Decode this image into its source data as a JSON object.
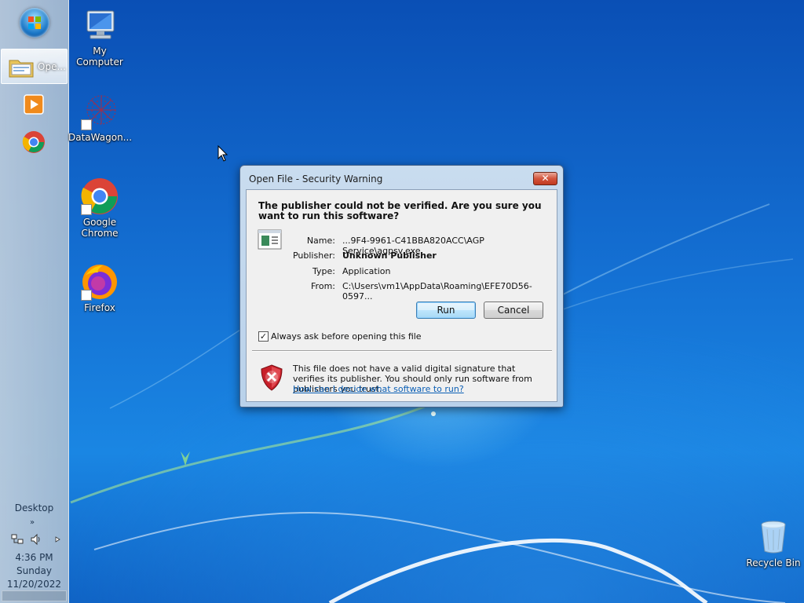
{
  "desktop": {
    "icons": [
      {
        "name": "My Computer",
        "icon": "computer-icon"
      },
      {
        "name": "DataWagon...",
        "icon": "datawagon-icon"
      },
      {
        "name": "Google Chrome",
        "icon": "chrome-icon"
      },
      {
        "name": "Firefox",
        "icon": "firefox-icon"
      },
      {
        "name": "Recycle Bin",
        "icon": "recycle-bin-icon"
      }
    ]
  },
  "taskbar": {
    "active_window_label": "Ope...",
    "pinned": [
      "media-player-icon",
      "chrome-icon"
    ],
    "desktop_label": "Desktop",
    "clock": {
      "time": "4:36 PM",
      "day": "Sunday",
      "date": "11/20/2022"
    }
  },
  "dialog": {
    "title": "Open File - Security Warning",
    "question": "The publisher could not be verified.  Are you sure you want to run this software?",
    "fields": [
      {
        "key": "Name:",
        "value": "...9F4-9961-C41BBA820ACC\\AGP Service\\agpsv.exe",
        "bold": false
      },
      {
        "key": "Publisher:",
        "value": "Unknown Publisher",
        "bold": true
      },
      {
        "key": "Type:",
        "value": "Application",
        "bold": false
      },
      {
        "key": "From:",
        "value": "C:\\Users\\vm1\\AppData\\Roaming\\EFE70D56-0597...",
        "bold": false
      }
    ],
    "run_label": "Run",
    "cancel_label": "Cancel",
    "close_label": "✕",
    "checkbox": {
      "label": "Always ask before opening this file",
      "checked": true,
      "mark": "✓"
    },
    "warning_text": "This file does not have a valid digital signature that verifies its publisher.  You should only run software from publishers you trust.",
    "help_link": "How can I decide what software to run?"
  },
  "colors": {
    "desktop_blue": "#1470d3",
    "link": "#0b5fb5",
    "close_red": "#c13a20"
  }
}
